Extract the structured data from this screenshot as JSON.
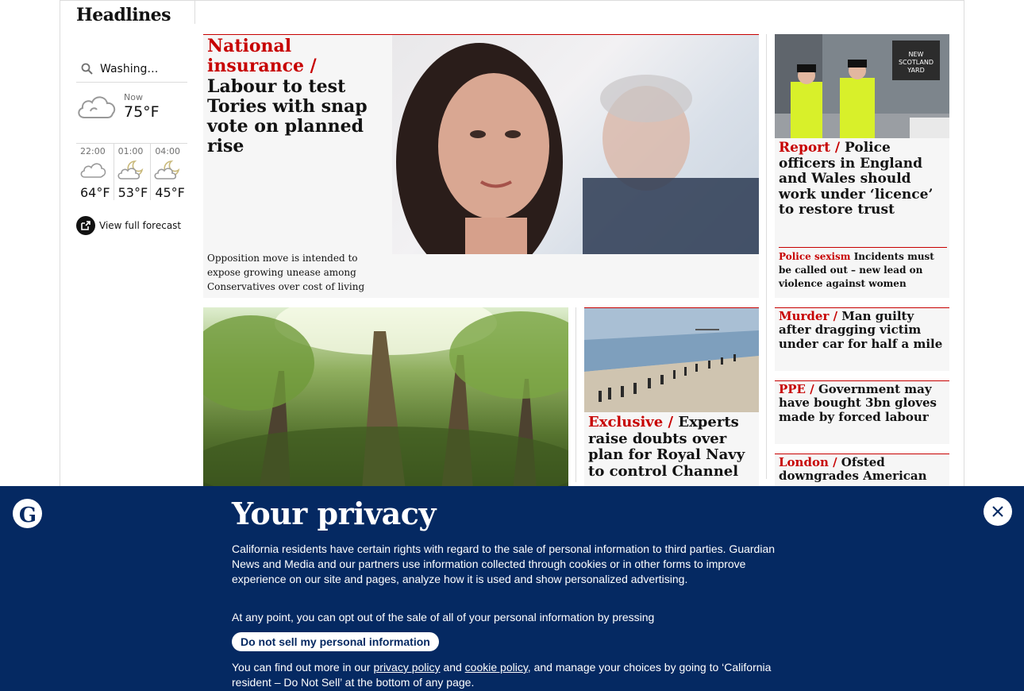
{
  "headlines_label": "Headlines",
  "weather": {
    "location": "Washing…",
    "now_label": "Now",
    "now_temp": "75°F",
    "forecast": [
      {
        "time": "22:00",
        "temp": "64°F",
        "icon": "cloud-night-icon"
      },
      {
        "time": "01:00",
        "temp": "53°F",
        "icon": "partly-cloudy-night-icon"
      },
      {
        "time": "04:00",
        "temp": "45°F",
        "icon": "partly-cloudy-night-icon"
      }
    ],
    "full_forecast": "View full forecast"
  },
  "feature": {
    "kicker": "National insurance /",
    "headline": "Labour to test Tories with snap vote on planned rise",
    "standfirst": "Opposition move is intended to expose growing unease among Conservatives over cost of living"
  },
  "side_story": {
    "image_sign": "NEW SCOTLAND YARD",
    "kicker": "Report /",
    "headline": "Police officers in England and Wales should work under ‘licence’ to restore trust",
    "sub_kicker": "Police sexism",
    "sub_text": "Incidents must be called out – new lead on violence against women"
  },
  "small_stories": [
    {
      "kicker": "Murder /",
      "headline": "Man guilty after dragging victim under car for half a mile"
    },
    {
      "kicker": "PPE /",
      "headline": "Government may have bought 3bn gloves made by forced labour"
    },
    {
      "kicker": "London /",
      "headline": "Ofsted downgrades American"
    }
  ],
  "beach_story": {
    "kicker": "Exclusive /",
    "headline": "Experts raise doubts over plan for Royal Navy to control Channel"
  },
  "privacy": {
    "title": "Your privacy",
    "p1": "California residents have certain rights with regard to the sale of personal information to third parties. Guardian News and Media and our partners use information collected through cookies or in other forms to improve experience on our site and pages, analyze how it is used and show personalized advertising.",
    "p2": "At any point, you can opt out of the sale of all of your personal information by pressing",
    "button": "Do not sell my personal information",
    "p3_start": "You can find out more in our ",
    "privacy_link": "privacy policy",
    "p3_and": " and ",
    "cookie_link": "cookie policy",
    "p3_end": ", and manage your choices by going to ‘California resident – Do Not Sell’ at the bottom of any page."
  },
  "colors": {
    "accent": "#c70000",
    "banner": "#052962",
    "card_bg": "#f6f6f6"
  }
}
